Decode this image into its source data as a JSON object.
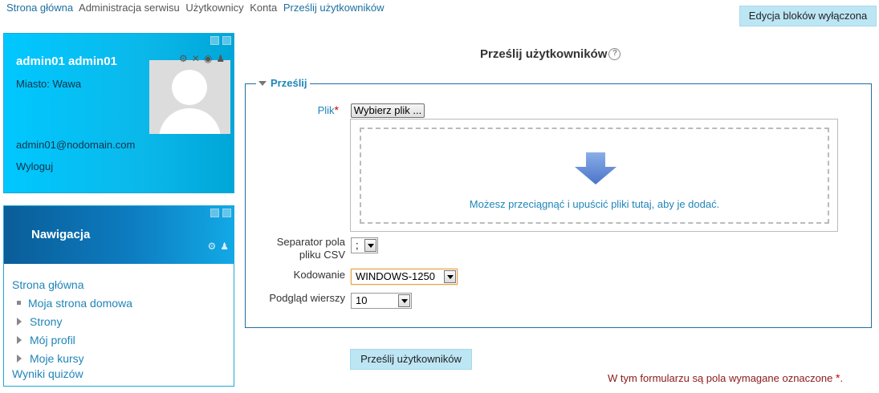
{
  "breadcrumb": {
    "items": [
      {
        "label": "Strona główna",
        "link": true
      },
      {
        "label": "Administracja serwisu",
        "link": false
      },
      {
        "label": "Użytkownicy",
        "link": false
      },
      {
        "label": "Konta",
        "link": false
      },
      {
        "label": "Prześlij użytkowników",
        "link": true
      }
    ]
  },
  "header": {
    "edit_blocks_label": "Edycja bloków wyłączona"
  },
  "profile": {
    "name": "admin01 admin01",
    "city": "Miasto: Wawa",
    "email": "admin01@nodomain.com",
    "logout": "Wyloguj",
    "icons": [
      "gear-icon",
      "close-icon",
      "eye-icon",
      "user-move-icon"
    ]
  },
  "navigation": {
    "title": "Nawigacja",
    "items": [
      {
        "label": "Strona główna",
        "level": 0,
        "bullet": "none"
      },
      {
        "label": "Moja strona domowa",
        "level": 1,
        "bullet": "square"
      },
      {
        "label": "Strony",
        "level": 1,
        "bullet": "triangle"
      },
      {
        "label": "Mój profil",
        "level": 1,
        "bullet": "triangle"
      },
      {
        "label": "Moje kursy",
        "level": 1,
        "bullet": "triangle"
      },
      {
        "label": "Wyniki quizów",
        "level": 0,
        "bullet": "none"
      }
    ]
  },
  "main": {
    "title": "Prześlij użytkowników",
    "help_glyph": "?",
    "section_legend": "Prześlij",
    "file_label": "Plik",
    "required_mark": "*",
    "choose_file_label": "Wybierz plik ...",
    "drop_text": "Możesz przeciągnąć i upuścić pliki tutaj, aby je dodać.",
    "separator_label": "Separator pola pliku CSV",
    "separator_value": ";",
    "encoding_label": "Kodowanie",
    "encoding_value": "WINDOWS-1250",
    "preview_label": "Podgląd wierszy",
    "preview_value": "10",
    "submit_label": "Prześlij użytkowników",
    "required_note": "W tym formularzu są pola wymagane oznaczone"
  },
  "colors": {
    "accent": "#1f85b8",
    "button_bg": "#bde6f5",
    "profile_bg": "#00c8ff",
    "nav_header_bg": "#0a5d98",
    "required": "#cc0000"
  }
}
